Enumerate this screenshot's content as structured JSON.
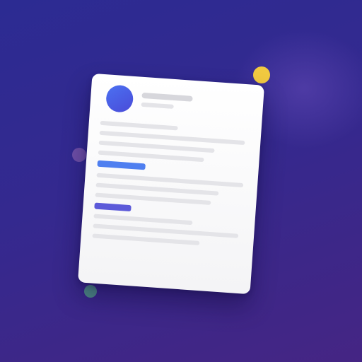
{
  "colors": {
    "avatar": "#4b62e6",
    "accent_blue": "#4f7ff0",
    "accent_indigo": "#5c5ad9",
    "dot_yellow": "#f1c940",
    "dot_purple": "#6e4fa6",
    "dot_teal": "#4f8d86"
  },
  "document": {
    "icon": "document-icon",
    "has_avatar": true,
    "header_lines": 2,
    "sections": 3
  },
  "decorations": [
    "yellow-dot",
    "purple-dot",
    "teal-dot"
  ]
}
